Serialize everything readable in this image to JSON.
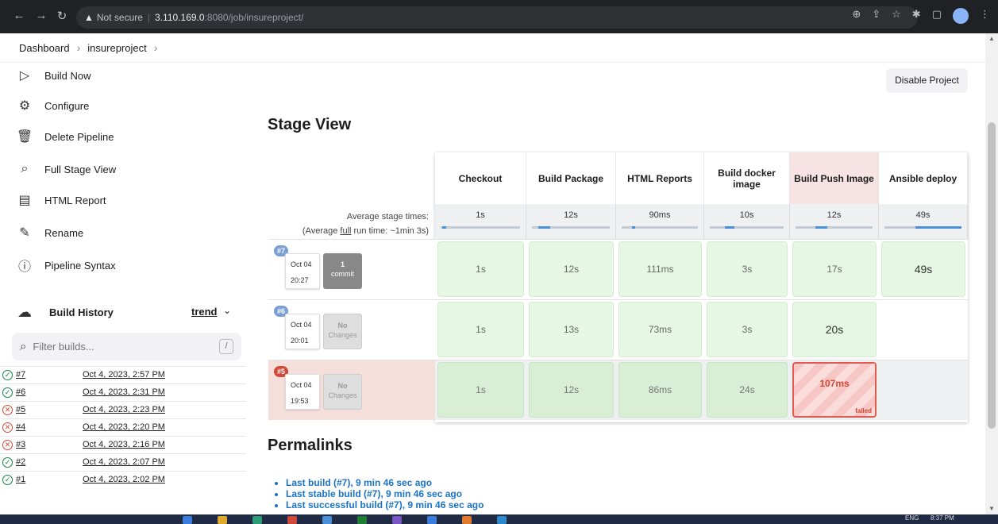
{
  "browser": {
    "security_label": "Not secure",
    "url_host": "3.110.169.0",
    "url_path": ":8080/job/insureproject/"
  },
  "breadcrumb": [
    "Dashboard",
    "insureproject"
  ],
  "sidebar": {
    "tasks": [
      {
        "label": "Build Now",
        "icon": "play-icon"
      },
      {
        "label": "Configure",
        "icon": "gear-icon"
      },
      {
        "label": "Delete Pipeline",
        "icon": "trash-icon"
      },
      {
        "label": "Full Stage View",
        "icon": "search-icon"
      },
      {
        "label": "HTML Report",
        "icon": "document-icon"
      },
      {
        "label": "Rename",
        "icon": "pencil-icon"
      },
      {
        "label": "Pipeline Syntax",
        "icon": "help-icon"
      }
    ],
    "build_history": {
      "title": "Build History",
      "trend_label": "trend",
      "filter_placeholder": "Filter builds...",
      "filter_shortcut": "/",
      "builds": [
        {
          "num": "#7",
          "date": "Oct 4, 2023, 2:57 PM",
          "status": "success"
        },
        {
          "num": "#6",
          "date": "Oct 4, 2023, 2:31 PM",
          "status": "success"
        },
        {
          "num": "#5",
          "date": "Oct 4, 2023, 2:23 PM",
          "status": "failed"
        },
        {
          "num": "#4",
          "date": "Oct 4, 2023, 2:20 PM",
          "status": "failed"
        },
        {
          "num": "#3",
          "date": "Oct 4, 2023, 2:16 PM",
          "status": "failed"
        },
        {
          "num": "#2",
          "date": "Oct 4, 2023, 2:07 PM",
          "status": "success"
        },
        {
          "num": "#1",
          "date": "Oct 4, 2023, 2:02 PM",
          "status": "success"
        }
      ]
    }
  },
  "main": {
    "disable_button": "Disable Project",
    "stage_view_title": "Stage View",
    "avg_label_line1": "Average stage times:",
    "avg_label_line2_prefix": "(Average ",
    "avg_label_line2_full": "full",
    "avg_label_line2_suffix": " run time: ~1min 3s)",
    "stages": [
      {
        "name": "Checkout",
        "avg": "1s",
        "fill": 0.05
      },
      {
        "name": "Build Package",
        "avg": "12s",
        "fill": 0.15
      },
      {
        "name": "HTML Reports",
        "avg": "90ms",
        "fill": 0.02
      },
      {
        "name": "Build docker image",
        "avg": "10s",
        "fill": 0.13
      },
      {
        "name": "Build Push Image",
        "avg": "12s",
        "fill": 0.15
      },
      {
        "name": "Ansible deploy",
        "avg": "49s",
        "fill": 0.6
      }
    ],
    "runs": [
      {
        "badge": "#7",
        "date": "Oct 04",
        "time": "20:27",
        "changes_count": "1",
        "changes_label": "commit",
        "status": "success",
        "cells": [
          "1s",
          "12s",
          "111ms",
          "3s",
          "17s",
          "49s"
        ]
      },
      {
        "badge": "#6",
        "date": "Oct 04",
        "time": "20:01",
        "changes_count": "No",
        "changes_label": "Changes",
        "status": "success",
        "cells": [
          "1s",
          "13s",
          "73ms",
          "3s",
          "20s",
          ""
        ]
      },
      {
        "badge": "#5",
        "date": "Oct 04",
        "time": "19:53",
        "changes_count": "No",
        "changes_label": "Changes",
        "status": "failed",
        "cells": [
          "1s",
          "12s",
          "86ms",
          "24s",
          "107ms",
          ""
        ],
        "failed_label": "failed"
      }
    ],
    "permalinks_title": "Permalinks",
    "permalinks": [
      "Last build (#7), 9 min 46 sec ago",
      "Last stable build (#7), 9 min 46 sec ago",
      "Last successful build (#7), 9 min 46 sec ago"
    ]
  },
  "taskbar": {
    "lang": "ENG",
    "time": "8:37 PM"
  }
}
